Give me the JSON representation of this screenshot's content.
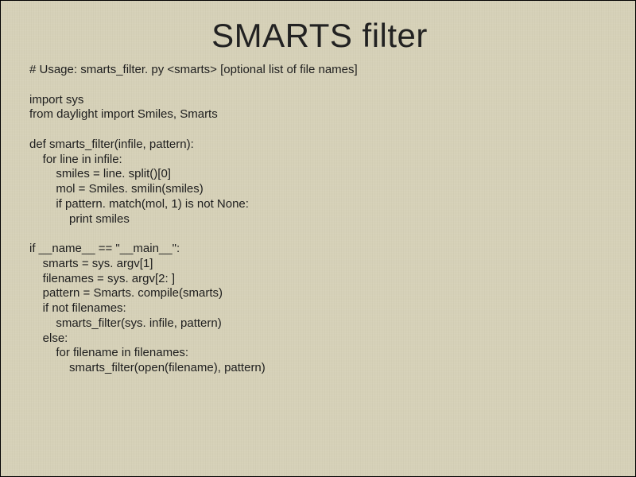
{
  "title": "SMARTS filter",
  "code_lines": [
    "# Usage: smarts_filter. py <smarts> [optional list of file names]",
    "",
    "import sys",
    "from daylight import Smiles, Smarts",
    "",
    "def smarts_filter(infile, pattern):",
    "    for line in infile:",
    "        smiles = line. split()[0]",
    "        mol = Smiles. smilin(smiles)",
    "        if pattern. match(mol, 1) is not None:",
    "            print smiles",
    "",
    "if __name__ == \"__main__\":",
    "    smarts = sys. argv[1]",
    "    filenames = sys. argv[2: ]",
    "    pattern = Smarts. compile(smarts)",
    "    if not filenames:",
    "        smarts_filter(sys. infile, pattern)",
    "    else:",
    "        for filename in filenames:",
    "            smarts_filter(open(filename), pattern)"
  ]
}
